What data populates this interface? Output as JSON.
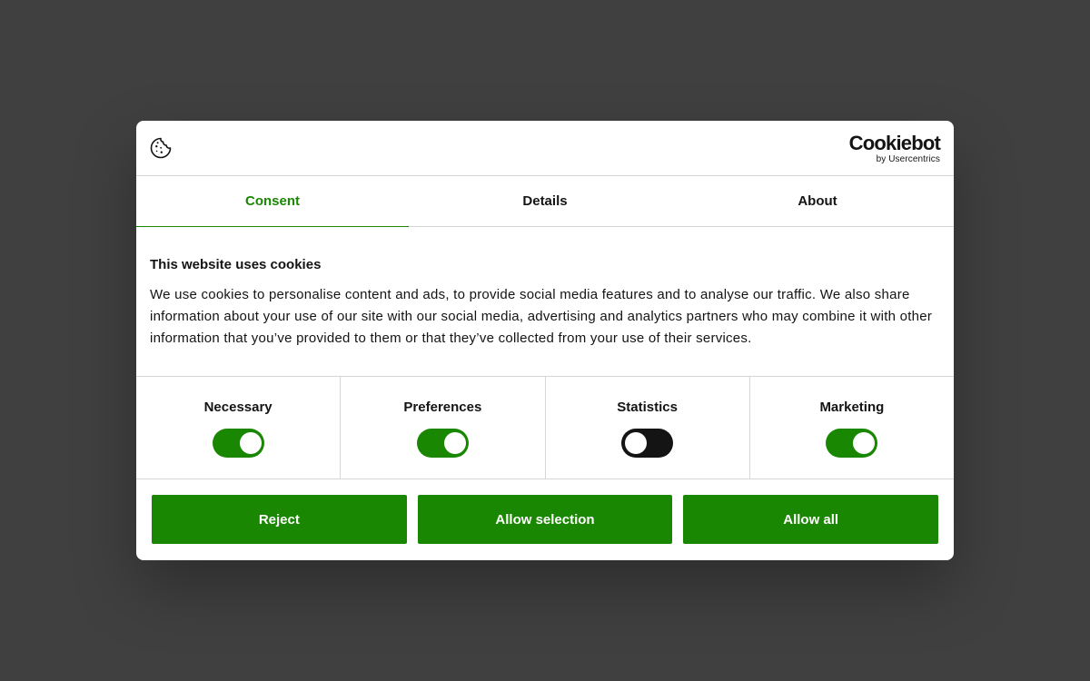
{
  "brand": {
    "name": "Cookiebot",
    "byline": "by Usercentrics"
  },
  "tabs": [
    {
      "label": "Consent",
      "active": true
    },
    {
      "label": "Details",
      "active": false
    },
    {
      "label": "About",
      "active": false
    }
  ],
  "content": {
    "title": "This website uses cookies",
    "text": "We use cookies to personalise content and ads, to provide social media features and to analyse our traffic. We also share information about your use of our site with our social media, advertising and analytics partners who may combine it with other information that you’ve provided to them or that they’ve collected from your use of their services."
  },
  "toggles": [
    {
      "label": "Necessary",
      "on": true
    },
    {
      "label": "Preferences",
      "on": true
    },
    {
      "label": "Statistics",
      "on": false
    },
    {
      "label": "Marketing",
      "on": true
    }
  ],
  "buttons": {
    "reject": "Reject",
    "allow_selection": "Allow selection",
    "allow_all": "Allow all"
  },
  "colors": {
    "accent": "#1a8703",
    "overlay": "#404040",
    "text": "#141414"
  }
}
